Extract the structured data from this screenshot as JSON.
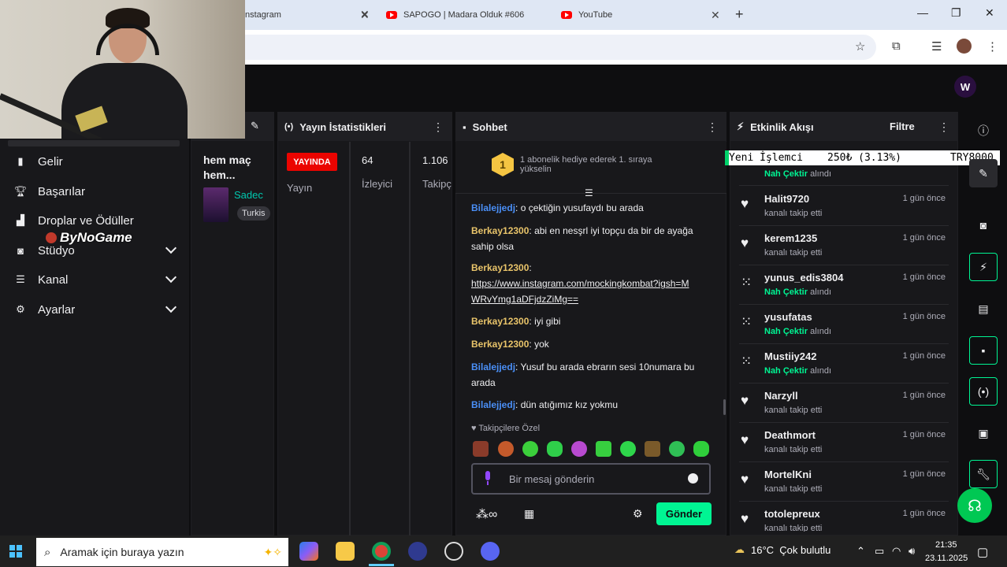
{
  "browser": {
    "tabs": [
      {
        "label": "nstagram"
      },
      {
        "label": "SAPOGO | Madara Olduk #606"
      },
      {
        "label": "YouTube"
      }
    ],
    "new_tab": "+",
    "minimize": "—",
    "maximize": "❐",
    "close": "✕"
  },
  "header": {
    "logo_letter": "W"
  },
  "overlay": {
    "brand": "ByNoGame"
  },
  "nav": {
    "items": [
      {
        "label": "Gelir"
      },
      {
        "label": "Başarılar"
      },
      {
        "label": "Droplar ve Ödüller"
      },
      {
        "label": "Stüdyo"
      },
      {
        "label": "Kanal"
      },
      {
        "label": "Ayarlar"
      }
    ]
  },
  "info": {
    "title": "hem maç hem...",
    "category": "Sadec",
    "tag": "Turkis"
  },
  "stats": {
    "title": "Yayın İstatistikleri",
    "live_badge": "YAYINDA",
    "stream_label": "Yayın",
    "viewers_value": "64",
    "viewers_label": "İzleyici",
    "followers_value": "1.106",
    "followers_label": "Takipç"
  },
  "chat": {
    "title": "Sohbet",
    "banner_rank": "1",
    "banner_text": "1 abonelik hediye ederek 1. sıraya yükselin",
    "messages": [
      {
        "user": "Bilalejjedj",
        "color": "blue",
        "text": "o çektiğin yusufaydı bu arada"
      },
      {
        "user": "Berkay12300",
        "color": "gold",
        "text": "abi en nesşrl iyi topçu da bir de ayağa sahip olsa"
      },
      {
        "user": "Berkay12300",
        "color": "gold",
        "text": "",
        "link": "https://www.instagram.com/mockingkombat?igsh=MWRvYmg1aDFjdzZiMg=="
      },
      {
        "user": "Berkay12300",
        "color": "gold",
        "text": "iyi gibi"
      },
      {
        "user": "Berkay12300",
        "color": "gold",
        "text": "yok"
      },
      {
        "user": "Bilalejjedj",
        "color": "blue",
        "text": "Yusuf bu arada ebrarın sesi 10numara bu arada"
      },
      {
        "user": "Bilalejjedj",
        "color": "blue",
        "text": "dün atığımız kız yokmu"
      }
    ],
    "followers_only": "Takipçilere Özel",
    "input_placeholder": "Bir mesaj gönderin",
    "send_label": "Gönder"
  },
  "events": {
    "title": "Etkinlik Akışı",
    "filter_label": "Filtre",
    "ticker_left": "Yeni İşlemci",
    "ticker_mid": "250₺ (3.13%)",
    "ticker_right": "TRY8000",
    "top_partial": {
      "prefix": "Nah Çektir",
      "suffix": "alındı"
    },
    "items": [
      {
        "user": "Halit9720",
        "time": "1 gün önce",
        "type": "follow",
        "desc": "kanalı takip etti"
      },
      {
        "user": "kerem1235",
        "time": "1 gün önce",
        "type": "follow",
        "desc": "kanalı takip etti"
      },
      {
        "user": "yunus_edis3804",
        "time": "1 gün önce",
        "type": "reward",
        "reward": "Nah Çektir",
        "desc": "alındı"
      },
      {
        "user": "yusufatas",
        "time": "1 gün önce",
        "type": "reward",
        "reward": "Nah Çektir",
        "desc": "alındı"
      },
      {
        "user": "Mustiiy242",
        "time": "1 gün önce",
        "type": "reward",
        "reward": "Nah Çektir",
        "desc": "alındı"
      },
      {
        "user": "Narzyll",
        "time": "1 gün önce",
        "type": "follow",
        "desc": "kanalı takip etti"
      },
      {
        "user": "Deathmort",
        "time": "1 gün önce",
        "type": "follow",
        "desc": "kanalı takip etti"
      },
      {
        "user": "MortelKni",
        "time": "1 gün önce",
        "type": "follow",
        "desc": "kanalı takip etti"
      },
      {
        "user": "totolepreux",
        "time": "1 gün önce",
        "type": "follow",
        "desc": "kanalı takip etti"
      }
    ]
  },
  "taskbar": {
    "search_placeholder": "Aramak için buraya yazın",
    "weather": "16°C  Çok bulutlu",
    "time": "21:35",
    "date": "23.11.2025"
  },
  "colors": {
    "twitch_green": "#00f593",
    "live_red": "#eb0400",
    "user_blue": "#4a8ff7",
    "user_gold": "#e9c46a"
  }
}
